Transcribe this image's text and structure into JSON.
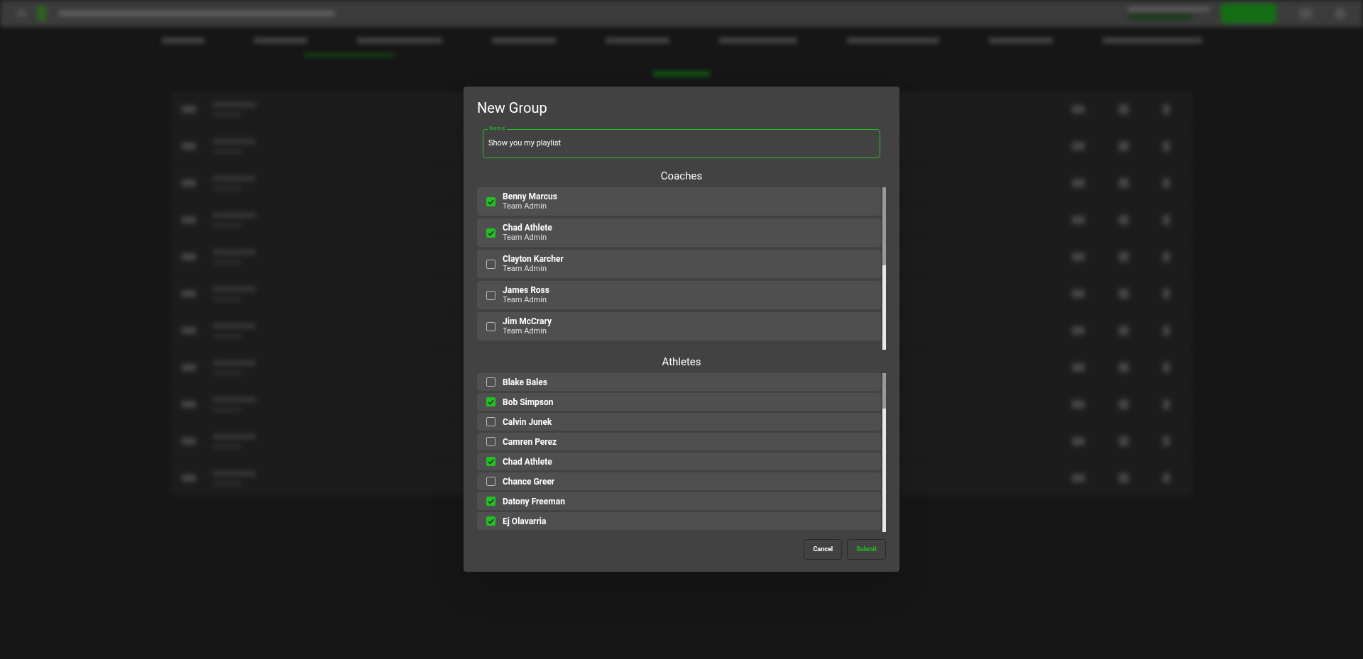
{
  "dialog": {
    "title": "New Group",
    "name_field": {
      "label": "Name",
      "value": "Show you my playlist"
    },
    "sections": [
      {
        "heading": "Coaches",
        "members": [
          {
            "name": "Benny Marcus",
            "role": "Team Admin",
            "checked": true
          },
          {
            "name": "Chad Athlete",
            "role": "Team Admin",
            "checked": true
          },
          {
            "name": "Clayton Karcher",
            "role": "Team Admin",
            "checked": false
          },
          {
            "name": "James Ross",
            "role": "Team Admin",
            "checked": false
          },
          {
            "name": "Jim McCrary",
            "role": "Team Admin",
            "checked": false
          }
        ]
      },
      {
        "heading": "Athletes",
        "members": [
          {
            "name": "Blake Bales",
            "checked": false
          },
          {
            "name": "Bob Simpson",
            "checked": true
          },
          {
            "name": "Calvin Junek",
            "checked": false
          },
          {
            "name": "Camren Perez",
            "checked": false
          },
          {
            "name": "Chad Athlete",
            "checked": true
          },
          {
            "name": "Chance Greer",
            "checked": false
          },
          {
            "name": "Datony Freeman",
            "checked": true
          },
          {
            "name": "Ej Olavarria",
            "checked": true
          }
        ]
      }
    ],
    "buttons": [
      {
        "label": "Cancel",
        "kind": "secondary"
      },
      {
        "label": "Submit",
        "kind": "primary"
      }
    ]
  }
}
